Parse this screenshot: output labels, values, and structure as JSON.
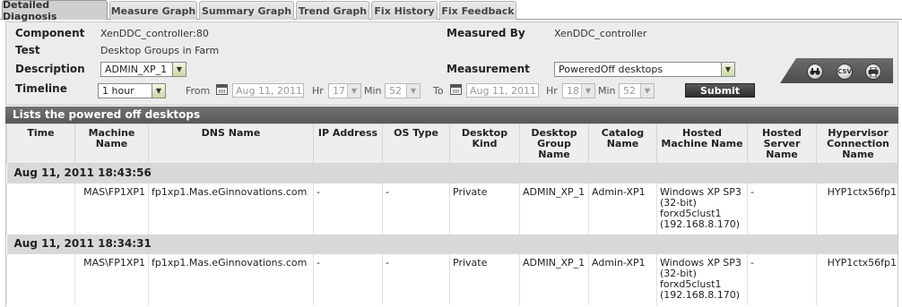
{
  "tabs": [
    {
      "label": "Detailed Diagnosis",
      "active": true
    },
    {
      "label": "Measure Graph",
      "active": false
    },
    {
      "label": "Summary Graph",
      "active": false
    },
    {
      "label": "Trend Graph",
      "active": false
    },
    {
      "label": "Fix History",
      "active": false
    },
    {
      "label": "Fix Feedback",
      "active": false
    }
  ],
  "filters": {
    "component_label": "Component",
    "component_value": "XenDDC_controller:80",
    "test_label": "Test",
    "test_value": "Desktop Groups in Farm",
    "description_label": "Description",
    "description_value": "ADMIN_XP_1",
    "measured_by_label": "Measured By",
    "measured_by_value": "XenDDC_controller",
    "measurement_label": "Measurement",
    "measurement_value": "PoweredOff desktops",
    "timeline_label": "Timeline",
    "timeline_value": "1 hour",
    "from_label": "From",
    "from_date": "Aug 11, 2011",
    "from_hr_label": "Hr",
    "from_hr": "17",
    "from_min_label": "Min",
    "from_min": "52",
    "to_label": "To",
    "to_date": "Aug 11, 2011",
    "to_hr_label": "Hr",
    "to_hr": "18",
    "to_min_label": "Min",
    "to_min": "52",
    "submit_label": "Submit"
  },
  "toolbar": {
    "csv_label": "CSV"
  },
  "section_title": "Lists the powered off desktops",
  "columns": [
    "Time",
    "Machine Name",
    "DNS Name",
    "IP Address",
    "OS Type",
    "Desktop Kind",
    "Desktop Group Name",
    "Catalog Name",
    "Hosted Machine Name",
    "Hosted Server Name",
    "Hypervisor Connection Name"
  ],
  "groups": [
    {
      "timestamp": "Aug 11, 2011 18:43:56",
      "row": {
        "time": "",
        "machine_name": "MAS\\FP1XP1",
        "dns_name": "fp1xp1.Mas.eGinnovations.com",
        "ip_address": "-",
        "os_type": "-",
        "desktop_kind": "Private",
        "desktop_group_name": "ADMIN_XP_1",
        "catalog_name": "Admin-XP1",
        "hosted_machine_name": "Windows XP SP3 (32-bit) forxd5clust1 (192.168.8.170)",
        "hosted_server_name": "-",
        "hypervisor_connection_name": "HYP1ctx56fp1"
      }
    },
    {
      "timestamp": "Aug 11, 2011 18:34:31",
      "row": {
        "time": "",
        "machine_name": "MAS\\FP1XP1",
        "dns_name": "fp1xp1.Mas.eGinnovations.com",
        "ip_address": "-",
        "os_type": "-",
        "desktop_kind": "Private",
        "desktop_group_name": "ADMIN_XP_1",
        "catalog_name": "Admin-XP1",
        "hosted_machine_name": "Windows XP SP3 (32-bit) forxd5clust1 (192.168.8.170)",
        "hosted_server_name": "-",
        "hypervisor_connection_name": "HYP1ctx56fp1"
      }
    }
  ]
}
